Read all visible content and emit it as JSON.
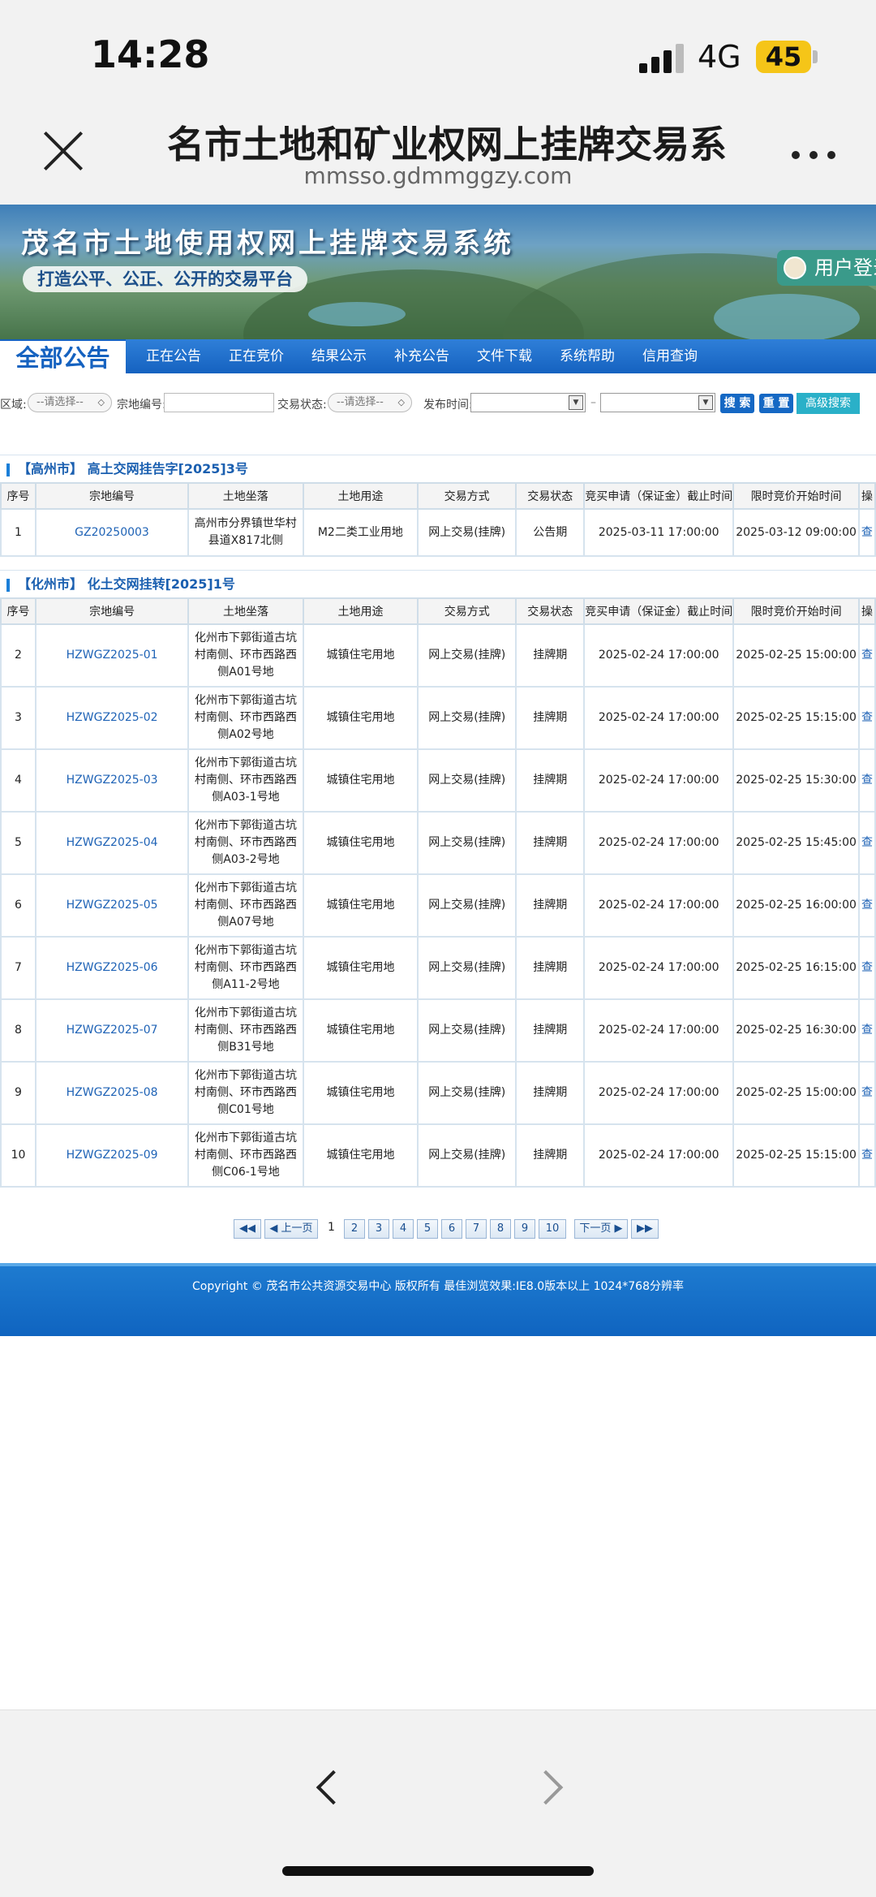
{
  "status_bar": {
    "time": "14:28",
    "network": "4G",
    "battery": "45"
  },
  "browser": {
    "heading": "名市土地和矿业权网上挂牌交易系",
    "url": "mmsso.gdmmggzy.com"
  },
  "banner": {
    "title": "茂名市土地使用权网上挂牌交易系统",
    "slogan": "打造公平、公正、公开的交易平台",
    "login": "用户登录"
  },
  "nav": {
    "active": "全部公告",
    "items": [
      "正在公告",
      "正在竞价",
      "结果公示",
      "补充公告",
      "文件下载",
      "系统帮助",
      "信用查询"
    ]
  },
  "search": {
    "region_label": "区域:",
    "region_value": "--请选择--",
    "parcel_label": "宗地编号:",
    "status_label": "交易状态:",
    "status_value": "--请选择--",
    "date_label": "发布时间:",
    "date_sep": "–",
    "search_btn": "搜 索",
    "reset_btn": "重 置",
    "advanced_btn": "高级搜索"
  },
  "table_headers": [
    "序号",
    "宗地编号",
    "土地坐落",
    "土地用途",
    "交易方式",
    "交易状态",
    "竞买申请（保证金）截止时间",
    "限时竞价开始时间",
    "操"
  ],
  "sections": [
    {
      "title": "【高州市】 高土交网挂告字[2025]3号",
      "rows": [
        {
          "no": "1",
          "code": "GZ20250003",
          "location": "高州市分界镇世华村县道X817北侧",
          "use": "M2二类工业用地",
          "method": "网上交易(挂牌)",
          "status": "公告期",
          "deadline": "2025-03-11 17:00:00",
          "start": "2025-03-12 09:00:00",
          "op": "查"
        }
      ]
    },
    {
      "title": "【化州市】 化土交网挂转[2025]1号",
      "rows": [
        {
          "no": "2",
          "code": "HZWGZ2025-01",
          "location": "化州市下郭街道古坑村南侧、环市西路西侧A01号地",
          "use": "城镇住宅用地",
          "method": "网上交易(挂牌)",
          "status": "挂牌期",
          "deadline": "2025-02-24 17:00:00",
          "start": "2025-02-25 15:00:00",
          "op": "查"
        },
        {
          "no": "3",
          "code": "HZWGZ2025-02",
          "location": "化州市下郭街道古坑村南侧、环市西路西侧A02号地",
          "use": "城镇住宅用地",
          "method": "网上交易(挂牌)",
          "status": "挂牌期",
          "deadline": "2025-02-24 17:00:00",
          "start": "2025-02-25 15:15:00",
          "op": "查"
        },
        {
          "no": "4",
          "code": "HZWGZ2025-03",
          "location": "化州市下郭街道古坑村南侧、环市西路西侧A03-1号地",
          "use": "城镇住宅用地",
          "method": "网上交易(挂牌)",
          "status": "挂牌期",
          "deadline": "2025-02-24 17:00:00",
          "start": "2025-02-25 15:30:00",
          "op": "查"
        },
        {
          "no": "5",
          "code": "HZWGZ2025-04",
          "location": "化州市下郭街道古坑村南侧、环市西路西侧A03-2号地",
          "use": "城镇住宅用地",
          "method": "网上交易(挂牌)",
          "status": "挂牌期",
          "deadline": "2025-02-24 17:00:00",
          "start": "2025-02-25 15:45:00",
          "op": "查"
        },
        {
          "no": "6",
          "code": "HZWGZ2025-05",
          "location": "化州市下郭街道古坑村南侧、环市西路西侧A07号地",
          "use": "城镇住宅用地",
          "method": "网上交易(挂牌)",
          "status": "挂牌期",
          "deadline": "2025-02-24 17:00:00",
          "start": "2025-02-25 16:00:00",
          "op": "查"
        },
        {
          "no": "7",
          "code": "HZWGZ2025-06",
          "location": "化州市下郭街道古坑村南侧、环市西路西侧A11-2号地",
          "use": "城镇住宅用地",
          "method": "网上交易(挂牌)",
          "status": "挂牌期",
          "deadline": "2025-02-24 17:00:00",
          "start": "2025-02-25 16:15:00",
          "op": "查"
        },
        {
          "no": "8",
          "code": "HZWGZ2025-07",
          "location": "化州市下郭街道古坑村南侧、环市西路西侧B31号地",
          "use": "城镇住宅用地",
          "method": "网上交易(挂牌)",
          "status": "挂牌期",
          "deadline": "2025-02-24 17:00:00",
          "start": "2025-02-25 16:30:00",
          "op": "查"
        },
        {
          "no": "9",
          "code": "HZWGZ2025-08",
          "location": "化州市下郭街道古坑村南侧、环市西路西侧C01号地",
          "use": "城镇住宅用地",
          "method": "网上交易(挂牌)",
          "status": "挂牌期",
          "deadline": "2025-02-24 17:00:00",
          "start": "2025-02-25 15:00:00",
          "op": "查"
        },
        {
          "no": "10",
          "code": "HZWGZ2025-09",
          "location": "化州市下郭街道古坑村南侧、环市西路西侧C06-1号地",
          "use": "城镇住宅用地",
          "method": "网上交易(挂牌)",
          "status": "挂牌期",
          "deadline": "2025-02-24 17:00:00",
          "start": "2025-02-25 15:15:00",
          "op": "查"
        }
      ]
    }
  ],
  "pagination": {
    "first": "◀◀",
    "prev": "◀ 上一页",
    "current": "1",
    "pages": [
      "2",
      "3",
      "4",
      "5",
      "6",
      "7",
      "8",
      "9",
      "10"
    ],
    "next": "下一页 ▶",
    "last": "▶▶"
  },
  "footer": {
    "copyright": "Copyright © 茂名市公共资源交易中心  版权所有  最佳浏览效果:IE8.0版本以上  1024*768分辨率"
  },
  "icons": {
    "close": "close-icon",
    "more": "more-icon",
    "user": "user-icon",
    "back": "back-arrow-icon",
    "forward": "forward-arrow-icon"
  },
  "colors": {
    "nav_blue": "#1562c0",
    "link_blue": "#1f63b6",
    "footer_blue": "#0f64c0",
    "battery": "#f5c518"
  }
}
